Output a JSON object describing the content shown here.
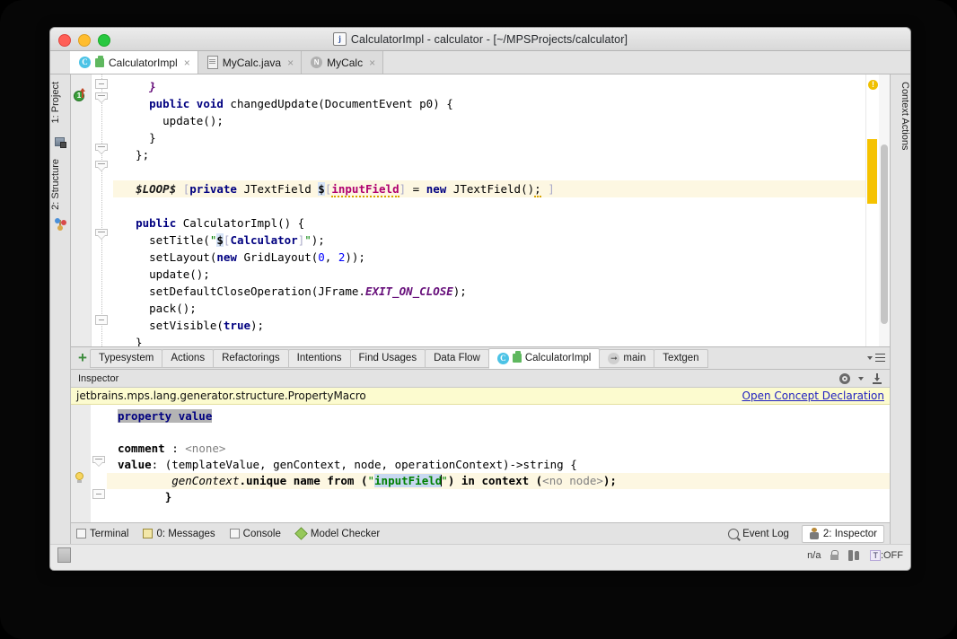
{
  "window": {
    "title": "CalculatorImpl - calculator - [~/MPSProjects/calculator]",
    "title_icon": "j",
    "traffic_lights": [
      "close-button",
      "minimize-button",
      "maximize-button"
    ]
  },
  "editor_tabs": [
    {
      "label": "CalculatorImpl",
      "icon": "concept-icon",
      "active": true,
      "close": "×"
    },
    {
      "label": "MyCalc.java",
      "icon": "java-file-icon",
      "active": false,
      "close": "×"
    },
    {
      "label": "MyCalc",
      "icon": "node-icon",
      "active": false,
      "close": "×"
    }
  ],
  "left_strip": [
    {
      "label": "1: Project",
      "shortcut": "1"
    },
    {
      "label": "2: Structure",
      "shortcut": "2"
    }
  ],
  "right_strip": [
    {
      "label": "Context Actions"
    }
  ],
  "code": {
    "lines": [
      {
        "id": "l1",
        "text": "    }"
      },
      {
        "id": "l2",
        "text": "    public void changedUpdate(DocumentEvent p0) {"
      },
      {
        "id": "l3",
        "text": "      update();"
      },
      {
        "id": "l4",
        "text": "    }"
      },
      {
        "id": "l5",
        "text": "  };"
      },
      {
        "id": "l6",
        "text": ""
      },
      {
        "id": "l7",
        "text": "  $LOOP$ [private JTextField $[inputField] = new JTextField(); ]",
        "highlighted": true
      },
      {
        "id": "l8",
        "text": ""
      },
      {
        "id": "l9",
        "text": "  public CalculatorImpl() {"
      },
      {
        "id": "l10",
        "text": "    setTitle(\"$[Calculator]\");"
      },
      {
        "id": "l11",
        "text": "    setLayout(new GridLayout(0, 2));"
      },
      {
        "id": "l12",
        "text": "    update();"
      },
      {
        "id": "l13",
        "text": "    setDefaultCloseOperation(JFrame.EXIT_ON_CLOSE);"
      },
      {
        "id": "l14",
        "text": "    pack();"
      },
      {
        "id": "l15",
        "text": "    setVisible(true);"
      },
      {
        "id": "l16",
        "text": "  }"
      }
    ],
    "warning_marker": "!",
    "tokens": {
      "loop_macro": "$LOOP$",
      "property_macro": "inputField",
      "title_macro": "Calculator"
    }
  },
  "tool_tabs": {
    "add_label": "+",
    "items": [
      {
        "label": "Typesystem",
        "active": false
      },
      {
        "label": "Actions",
        "active": false
      },
      {
        "label": "Refactorings",
        "active": false
      },
      {
        "label": "Intentions",
        "active": false
      },
      {
        "label": "Find Usages",
        "active": false
      },
      {
        "label": "Data Flow",
        "active": false
      },
      {
        "label": "CalculatorImpl",
        "active": true,
        "icon": "concept-icon"
      },
      {
        "label": "main",
        "active": false,
        "icon": "run-icon"
      },
      {
        "label": "Textgen",
        "active": false
      }
    ],
    "overflow_icon": "list-dropdown-icon"
  },
  "inspector": {
    "header_label": "Inspector",
    "gear_icon": "gear-icon",
    "minimize_icon": "hide-icon",
    "concept_fqn": "jetbrains.mps.lang.generator.structure.PropertyMacro",
    "open_concept_link": "Open Concept Declaration",
    "lines": {
      "property_value": "property value",
      "comment_label": "comment",
      "comment_value": "<none>",
      "value_label": "value",
      "value_signature": ": (templateValue, genContext, node, operationContext)->string {",
      "body_prefix": "genContext",
      "body_mid": ".unique name from (",
      "body_quote_open": "\"",
      "body_selected": "inputField",
      "body_quote_close": "\"",
      "body_tail": ") in context (",
      "body_nonode": "<no node>",
      "body_end": ");",
      "closing_brace": "}"
    }
  },
  "bottom_bar": {
    "left_items": [
      {
        "label": "Terminal",
        "icon": "terminal-icon",
        "active": false
      },
      {
        "label": "0: Messages",
        "icon": "messages-icon",
        "active": false,
        "shortcut": "0"
      },
      {
        "label": "Console",
        "icon": "console-icon",
        "active": false
      },
      {
        "label": "Model Checker",
        "icon": "model-checker-icon",
        "active": false
      }
    ],
    "right_items": [
      {
        "label": "Event Log",
        "icon": "search-icon",
        "active": false
      },
      {
        "label": "2: Inspector",
        "icon": "inspector-icon",
        "active": true,
        "shortcut": "2"
      }
    ]
  },
  "status_bar": {
    "memory_icon": "memory-indicator-icon",
    "encoding": "n/a",
    "lock_icon": "lock-icon",
    "plug_icon": "power-icon",
    "typing_label": "T",
    "typing_state": ":OFF"
  },
  "colors": {
    "window_chrome": "#e3e3e3",
    "editor_bg": "#ffffff",
    "highlight_line": "#fdf7e2",
    "concept_bar": "#fcfbcf",
    "keyword": "#000080",
    "string": "#008000",
    "property": "#b00070",
    "static_field": "#660e7a",
    "link": "#2020c0",
    "warning": "#f5c200",
    "accent_green": "#3a8a3a"
  }
}
